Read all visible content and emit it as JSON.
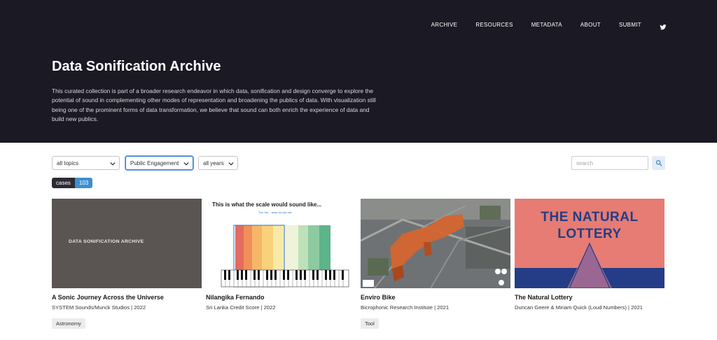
{
  "nav": {
    "items": [
      "ARCHIVE",
      "RESOURCES",
      "METADATA",
      "ABOUT",
      "SUBMIT"
    ],
    "twitter_icon": "twitter-icon"
  },
  "hero": {
    "title": "Data Sonification Archive",
    "intro": "This curated collection is part of a broader research endeavor in which data, sonification and design converge to explore the potential of sound in complementing other modes of representation and broadening the publics of data. With visualization still being one of the prominent forms of data transformation, we believe that sound can both enrich the experience of data and build new publics."
  },
  "filters": {
    "topics": "all topics",
    "category": "Public Engagement",
    "years": "all years",
    "search_placeholder": "search"
  },
  "count": {
    "label": "cases",
    "value": "103"
  },
  "cards": [
    {
      "thumb_text": "DATA SONIFICATION ARCHIVE",
      "title": "A Sonic Journey Across the Universe",
      "meta": "SYSTEM Sounds/Munck Studios | 2022",
      "tag": "Astronomy"
    },
    {
      "thumb_title": "This is what the scale would sound like...",
      "thumb_sub": "The 'hm... keep an eye out'",
      "title": "Nilangika Fernando",
      "meta": "Sri Lanka Credit Score | 2022",
      "tag": ""
    },
    {
      "title": "Enviro Bike",
      "meta": "Bicrophonic Research Institute | 2021",
      "tag": "Tool"
    },
    {
      "thumb_line1": "THE NATURAL",
      "thumb_line2": "LOTTERY",
      "title": "The Natural Lottery",
      "meta": "Duncan Geere & Miriam Quick (Loud Numbers) | 2021",
      "tag": ""
    }
  ],
  "colors": {
    "header_bg": "#1b1923",
    "accent": "#3e8ed0"
  }
}
